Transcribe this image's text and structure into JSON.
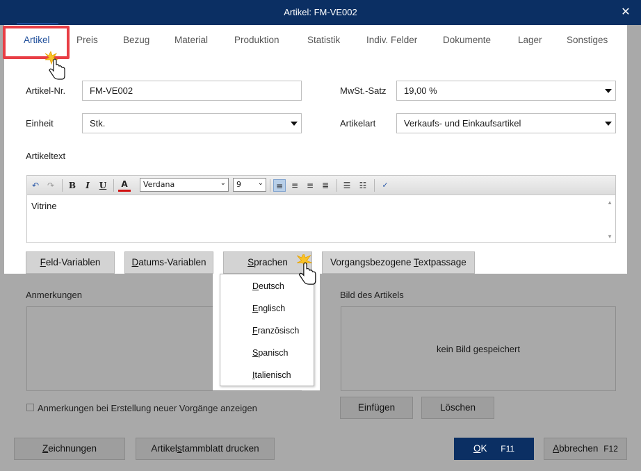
{
  "window": {
    "title": "Artikel: FM-VE002",
    "close_glyph": "✕"
  },
  "tabs": [
    {
      "label": "Artikel",
      "active": true
    },
    {
      "label": "Preis"
    },
    {
      "label": "Bezug"
    },
    {
      "label": "Material"
    },
    {
      "label": "Produktion"
    },
    {
      "label": "Statistik"
    },
    {
      "label": "Indiv. Felder"
    },
    {
      "label": "Dokumente"
    },
    {
      "label": "Lager"
    },
    {
      "label": "Sonstiges"
    }
  ],
  "form": {
    "artikelnr_label": "Artikel-Nr.",
    "artikelnr_value": "FM-VE002",
    "einheit_label": "Einheit",
    "einheit_value": "Stk.",
    "mwst_label": "MwSt.-Satz",
    "mwst_value": "19,00 %",
    "artikelart_label": "Artikelart",
    "artikelart_value": "Verkaufs- und Einkaufsartikel",
    "artikeltext_label": "Artikeltext"
  },
  "editor": {
    "font": "Verdana",
    "size": "9",
    "content": "Vitrine",
    "icons": [
      "undo-icon",
      "redo-icon",
      "bold-icon",
      "italic-icon",
      "underline-icon",
      "font-color-icon",
      "align-left-icon",
      "align-center-icon",
      "align-right-icon",
      "justify-icon",
      "bullet-list-icon",
      "numbered-list-icon",
      "spellcheck-icon"
    ]
  },
  "buttons": {
    "feld_variablen": {
      "pre": "",
      "u": "F",
      "post": "eld-Variablen"
    },
    "datums_variablen": {
      "pre": "",
      "u": "D",
      "post": "atums-Variablen"
    },
    "sprachen": {
      "pre": "",
      "u": "S",
      "post": "prachen"
    },
    "vorgangs": {
      "pre": "Vorgangsbezogene ",
      "u": "T",
      "post": "extpassage"
    },
    "einfuegen": "Einfügen",
    "loeschen": "Löschen",
    "zeichnungen": {
      "pre": "",
      "u": "Z",
      "post": "eichnungen"
    },
    "artikelstammblatt": {
      "pre": "Artikel",
      "u": "s",
      "post": "tammblatt drucken"
    },
    "ok": {
      "u": "O",
      "post": "K",
      "shortcut": "F11"
    },
    "abbrechen": {
      "u": "A",
      "post": "bbrechen",
      "shortcut": "F12"
    }
  },
  "sections": {
    "anmerkungen_label": "Anmerkungen",
    "bild_label": "Bild des Artikels",
    "kein_bild": "kein Bild gespeichert",
    "checkbox_label": "Anmerkungen bei Erstellung neuer Vorgänge anzeigen"
  },
  "sprachen_menu": [
    {
      "u": "D",
      "post": "eutsch"
    },
    {
      "u": "E",
      "post": "nglisch"
    },
    {
      "u": "F",
      "post": "ranzösisch"
    },
    {
      "u": "S",
      "post": "panisch"
    },
    {
      "u": "I",
      "post": "talienisch"
    }
  ],
  "colors": {
    "titlebar": "#0b2f63",
    "accent": "#1d4d9a",
    "highlight": "#e83e45",
    "overlay": "#a9a9a9"
  }
}
